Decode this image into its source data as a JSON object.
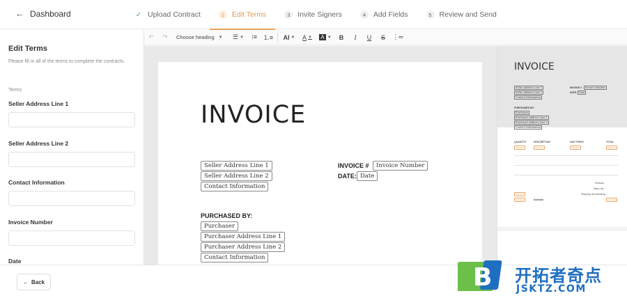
{
  "header": {
    "back_label": "Dashboard",
    "steps": [
      {
        "num": "✓",
        "label": "Upload Contract"
      },
      {
        "num": "2",
        "label": "Edit Terms"
      },
      {
        "num": "3",
        "label": "Invite Signers"
      },
      {
        "num": "4",
        "label": "Add Fields"
      },
      {
        "num": "5",
        "label": "Review and Send"
      }
    ]
  },
  "sidebar": {
    "title": "Edit Terms",
    "description": "Please fill in all of the terms to complete the contracts.",
    "terms_label": "Terms",
    "fields": [
      {
        "label": "Seller Address Line 1",
        "value": ""
      },
      {
        "label": "Seller Address Line 2",
        "value": ""
      },
      {
        "label": "Contact Information",
        "value": ""
      },
      {
        "label": "Invoice Number",
        "value": ""
      },
      {
        "label": "Date",
        "value": ""
      }
    ]
  },
  "toolbar": {
    "heading_select": "Choose heading"
  },
  "document": {
    "title": "INVOICE",
    "seller_address_1": "Seller Address Line 1",
    "seller_address_2": "Seller Address Line 2",
    "contact_info": "Contact Information",
    "invoice_label": "INVOICE #",
    "invoice_number": "Invoice Number",
    "date_label": "DATE:",
    "date": "Date",
    "purchased_by": "PURCHASED BY:",
    "purchaser": "Purchaser",
    "purchaser_address_1": "Purchaser Address Line 1",
    "purchaser_address_2": "Purchaser Address Line 2",
    "purchaser_contact": "Contact Information"
  },
  "preview": {
    "title": "INVOICE",
    "invoice_label": "INVOICE #",
    "invoice_number": "Invoice Number",
    "date_label": "DATE:",
    "date": "Date",
    "seller_address_1": "Seller Address Line 1",
    "seller_address_2": "Seller Address Line 2",
    "contact_info": "Contact Information",
    "purchased_by": "PURCHASED BY:",
    "purchaser": "Purchaser",
    "purchaser_address_1": "Purchaser Address Line 1",
    "purchaser_address_2": "Purchaser Address Line 2",
    "purchaser_contact": "Contact Information",
    "columns": [
      "QUANTITY",
      "DESCRIPTION",
      "UNIT PRICE",
      "TOTAL"
    ],
    "chip_text": "Add Item",
    "subtotal_label": "Subtotal",
    "tax_label": "Sales tax",
    "shipping_label": "Shipping and handling",
    "footer_subtotal": "Subtotal"
  },
  "footer": {
    "back_label": "Back"
  },
  "watermark": {
    "cn": "开拓者奇点",
    "en": "JSKTZ.COM",
    "letter": "B"
  },
  "colors": {
    "accent": "#e8a462",
    "done": "#5aa86a",
    "watermark_blue": "#1f6fc0",
    "watermark_green": "#6cc04a"
  }
}
